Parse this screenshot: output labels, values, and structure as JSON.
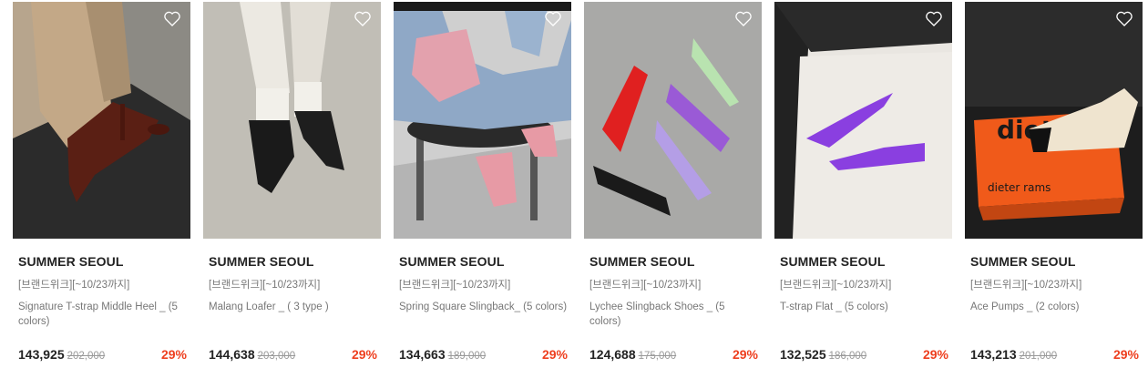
{
  "products": [
    {
      "brand": "SUMMER SEOUL",
      "promo": "[브랜드위크][~10/23까지]",
      "title": "Signature T-strap Middle Heel _ (5 colors)",
      "price": "143,925",
      "original_price": "202,000",
      "discount": "29%",
      "image": "brown-tstrap-heel-photo",
      "colors": {
        "bg": "#b7a58d",
        "floor": "#2b2b2b",
        "item": "#5a1f14"
      }
    },
    {
      "brand": "SUMMER SEOUL",
      "promo": "[브랜드위크][~10/23까지]",
      "title": "Malang Loafer _ ( 3 type )",
      "price": "144,638",
      "original_price": "203,000",
      "discount": "29%",
      "image": "black-loafer-photo",
      "colors": {
        "bg": "#c9c6bf",
        "floor": "#a8a49d",
        "item": "#1a1a1a"
      }
    },
    {
      "brand": "SUMMER SEOUL",
      "promo": "[브랜드위크][~10/23까지]",
      "title": "Spring Square Slingback_ (5 colors)",
      "price": "134,663",
      "original_price": "189,000",
      "discount": "29%",
      "image": "pink-slingback-photo",
      "colors": {
        "bg": "#cfcfcf",
        "floor": "#b0b0b0",
        "item": "#e79aa5"
      }
    },
    {
      "brand": "SUMMER SEOUL",
      "promo": "[브랜드위크][~10/23까지]",
      "title": "Lychee Slingback Shoes _ (5 colors)",
      "price": "124,688",
      "original_price": "175,000",
      "discount": "29%",
      "image": "colorful-slingbacks-photo",
      "colors": {
        "bg": "#a9a9a7",
        "floor": "#9a9a98",
        "item": "#9a5ad6"
      }
    },
    {
      "brand": "SUMMER SEOUL",
      "promo": "[브랜드위크][~10/23까지]",
      "title": "T-strap Flat _ (5 colors)",
      "price": "132,525",
      "original_price": "186,000",
      "discount": "29%",
      "image": "purple-tstrap-flat-photo",
      "colors": {
        "bg": "#e9e6e1",
        "floor": "#222222",
        "item": "#8a3fe0"
      }
    },
    {
      "brand": "SUMMER SEOUL",
      "promo": "[브랜드위크][~10/23까지]",
      "title": "Ace Pumps _ (2 colors)",
      "price": "143,213",
      "original_price": "201,000",
      "discount": "29%",
      "image": "ace-pumps-on-book-photo",
      "colors": {
        "bg": "#1d1d1d",
        "floor": "#f05a1a",
        "item": "#efe4cf"
      }
    }
  ],
  "book_text": "dieter rams",
  "wishlist_icon": "heart-outline-icon"
}
